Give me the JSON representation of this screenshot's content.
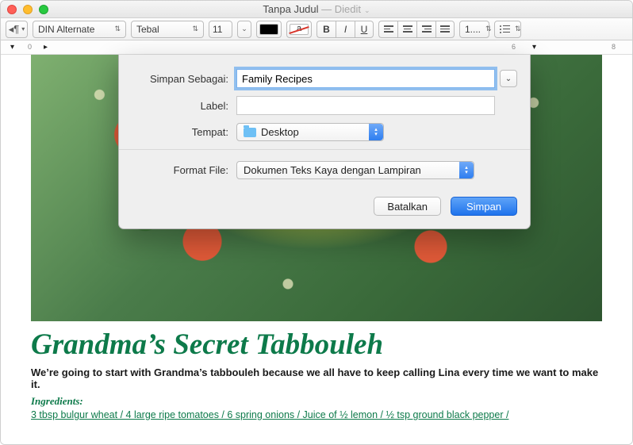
{
  "window": {
    "title": "Tanpa Judul",
    "title_suffix": " — Diedit"
  },
  "toolbar": {
    "font": "DIN Alternate",
    "weight": "Tebal",
    "size": "11",
    "spacing": "1....",
    "bold": "B",
    "italic": "I",
    "underline": "U"
  },
  "ruler": {
    "n0": "0",
    "n6": "6",
    "n8": "8"
  },
  "dialog": {
    "save_as_label": "Simpan Sebagai:",
    "save_as_value": "Family Recipes",
    "tags_label": "Label:",
    "tags_value": "",
    "where_label": "Tempat:",
    "where_value": "Desktop",
    "format_label": "Format File:",
    "format_value": "Dokumen Teks Kaya dengan Lampiran",
    "cancel": "Batalkan",
    "save": "Simpan"
  },
  "document": {
    "recipe_title": "Grandma’s Secret Tabbouleh",
    "intro": "We’re going to start with Grandma’s tabbouleh because we all have to keep calling Lina every time we want to make it.",
    "ingredients_heading": "Ingredients:",
    "ingredients_line": "3 tbsp bulgur wheat / 4 large ripe tomatoes / 6 spring onions / Juice of ½ lemon / ½ tsp ground black pepper /"
  }
}
